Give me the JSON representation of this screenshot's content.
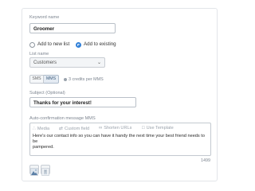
{
  "keyword": {
    "label": "Keyword name",
    "value": "Groomer"
  },
  "list_choice": {
    "options": [
      {
        "label": "Add to new list",
        "selected": false
      },
      {
        "label": "Add to existing",
        "selected": true
      }
    ]
  },
  "list_name": {
    "label": "List name",
    "value": "Customers"
  },
  "message_type": {
    "options": [
      "SMS",
      "MMS"
    ],
    "active": "MMS",
    "credits": "3 credits per MMS"
  },
  "subject": {
    "label": "Subject (Optional)",
    "value": "Thanks for your interest!"
  },
  "auto_message": {
    "label": "Auto-confirmation message MMS",
    "toolbar": [
      "Media",
      "Custom field",
      "Shorten URLs",
      "Use Template"
    ],
    "text_line1": "Here's our contact info so you can have it handy the next time your best friend needs to be",
    "text_line2": "pampered.",
    "char_count": "1499"
  },
  "colors": {
    "accent": "#2f7fd8",
    "border": "#c3c9d0",
    "label": "#7d8590"
  }
}
